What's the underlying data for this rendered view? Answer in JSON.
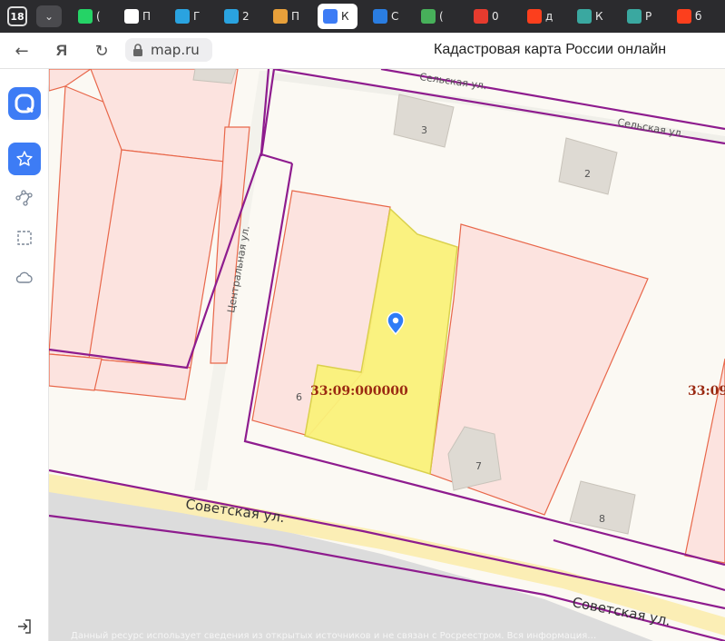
{
  "browser": {
    "tab_count": "18",
    "tabs": [
      {
        "icon": "whatsapp-icon",
        "color": "#25d366",
        "title": "("
      },
      {
        "icon": "document-icon",
        "color": "#ffffff",
        "title": "П"
      },
      {
        "icon": "telegram-icon",
        "color": "#2aa3e0",
        "title": "Г"
      },
      {
        "icon": "telegram-icon",
        "color": "#2aa3e0",
        "title": "2"
      },
      {
        "icon": "colorful-wheel-icon",
        "color": "#e8a03a",
        "title": "П"
      },
      {
        "icon": "map-app-icon",
        "color": "#3d7cf5",
        "title": "К"
      },
      {
        "icon": "circle-logo-icon",
        "color": "#2a7de1",
        "title": "С"
      },
      {
        "icon": "house-logo-icon",
        "color": "#47b05a",
        "title": "("
      },
      {
        "icon": "shield-icon",
        "color": "#e63b2e",
        "title": "0"
      },
      {
        "icon": "yandex-icon",
        "color": "#fc3f1d",
        "title": "д"
      },
      {
        "icon": "striped-logo-icon",
        "color": "#3aa8a0",
        "title": "К"
      },
      {
        "icon": "striped-logo-icon",
        "color": "#3aa8a0",
        "title": "Р"
      },
      {
        "icon": "yandex-icon",
        "color": "#fc3f1d",
        "title": "б"
      }
    ],
    "active_tab_index": 5,
    "url": "map.ru",
    "page_title": "Кадастровая карта России онлайн",
    "browser_logo": "Я"
  },
  "map": {
    "streets": {
      "selskaya_1": "Сельская ул.",
      "selskaya_2": "Сельская ул.",
      "centralnaya": "Центральная ул.",
      "sovetskaya_1": "Советская ул.",
      "sovetskaya_2": "Советская ул."
    },
    "house_numbers": {
      "h3": "3",
      "h2": "2",
      "h6": "6",
      "h7": "7",
      "h8": "8"
    },
    "cadastral_number": "33:09:000000",
    "cadastral_number_edge": "33:09",
    "attribution": "Данный ресурс использует сведения из открытых источников и не связан с Росреестром. Вся информация…"
  },
  "colors": {
    "parcel_border": "#e8674a",
    "parcel_fill": "#fce3df",
    "selected_parcel_fill": "#faf27a",
    "selected_parcel_border": "#d9cf45",
    "quarter_border": "#8e1c8e",
    "cadastral_label": "#9a2a12",
    "marker": "#2e7cf6",
    "accent": "#3d7cf5"
  }
}
